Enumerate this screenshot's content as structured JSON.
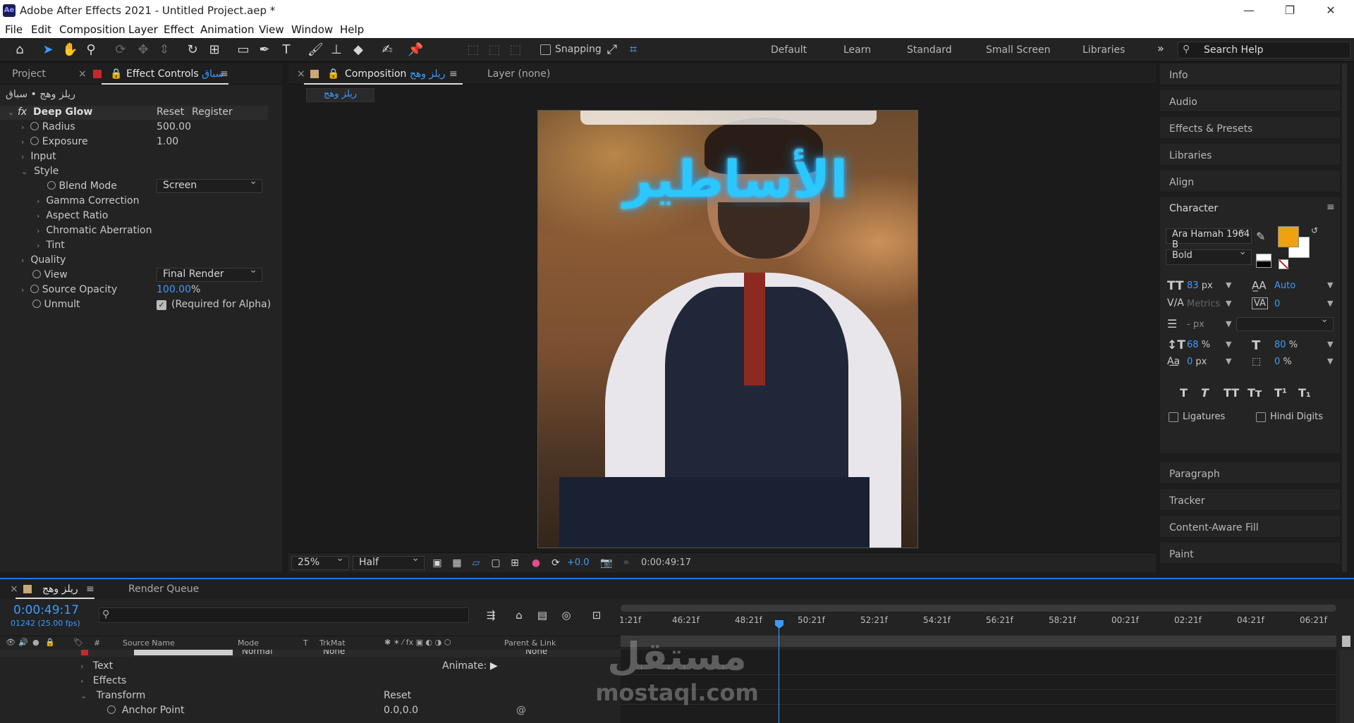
{
  "window": {
    "title": "Adobe After Effects 2021 - Untitled Project.aep *",
    "app_icon": "Ae",
    "minimize": "—",
    "maximize": "❐",
    "close": "✕"
  },
  "menu": [
    "File",
    "Edit",
    "Composition",
    "Layer",
    "Effect",
    "Animation",
    "View",
    "Window",
    "Help"
  ],
  "toolbar": {
    "snapping_label": "Snapping",
    "workspaces": [
      "Default",
      "Learn",
      "Standard",
      "Small Screen",
      "Libraries"
    ],
    "overflow": "»",
    "search_placeholder": "Search Help"
  },
  "left_panel": {
    "tab_project": "Project",
    "tab_effect_controls": "Effect Controls",
    "tab_layer_name": "سباق",
    "breadcrumb": "ريلز وهج • سباق",
    "effect": {
      "name": "Deep Glow",
      "fx": "fx",
      "reset": "Reset",
      "register": "Register",
      "radius_label": "Radius",
      "radius_value": "500.00",
      "exposure_label": "Exposure",
      "exposure_value": "1.00",
      "input_label": "Input",
      "style_label": "Style",
      "blend_mode_label": "Blend Mode",
      "blend_mode_value": "Screen",
      "gamma_label": "Gamma Correction",
      "aspect_label": "Aspect Ratio",
      "chromatic_label": "Chromatic Aberration",
      "tint_label": "Tint",
      "quality_label": "Quality",
      "view_label": "View",
      "view_value": "Final Render",
      "source_opacity_label": "Source Opacity",
      "source_opacity_value": "100.00",
      "source_opacity_unit": "%",
      "unmult_label": "Unmult",
      "unmult_note": "(Required for Alpha)"
    }
  },
  "comp_panel": {
    "tab_composition": "Composition",
    "comp_name": "ريلز وهج",
    "tab_layer": "Layer",
    "layer_none": "(none)",
    "comp_subtab": "ريلز وهج",
    "overlay_text": "الأساطير",
    "footer": {
      "zoom": "25%",
      "resolution": "Half",
      "exposure": "+0.0",
      "timecode": "0:00:49:17"
    }
  },
  "right_panel": {
    "items_top": [
      "Info",
      "Audio",
      "Effects & Presets",
      "Libraries",
      "Align"
    ],
    "character": {
      "title": "Character",
      "font": "Ara Hamah 1964 B",
      "style": "Bold",
      "fill_color": "#f0a010",
      "size": "83",
      "size_unit": "px",
      "leading": "Auto",
      "kerning": "Metrics",
      "tracking": "0",
      "stroke": "-",
      "stroke_unit": "px",
      "vscale": "68",
      "vscale_unit": "%",
      "hscale": "80",
      "hscale_unit": "%",
      "baseline": "0",
      "baseline_unit": "px",
      "tsume": "0",
      "tsume_unit": "%",
      "styles": [
        "T",
        "T",
        "TT",
        "Tт",
        "T¹",
        "T₁"
      ],
      "ligatures": "Ligatures",
      "hindi_digits": "Hindi Digits"
    },
    "items_bottom": [
      "Paragraph",
      "Tracker",
      "Content-Aware Fill",
      "Paint"
    ]
  },
  "timeline": {
    "tab_comp": "ريلز وهج",
    "tab_render_queue": "Render Queue",
    "current_time": "0:00:49:17",
    "frame_info": "01242 (25.00 fps)",
    "columns": {
      "num": "#",
      "source": "Source Name",
      "mode": "Mode",
      "t": "T",
      "trkmat": "TrkMat",
      "parent": "Parent & Link"
    },
    "layer_row": {
      "mode": "Normal",
      "trkmat": "None",
      "parent": "None"
    },
    "rows": {
      "text": "Text",
      "animate": "Animate:",
      "effects": "Effects",
      "transform": "Transform",
      "reset": "Reset",
      "anchor_point": "Anchor Point",
      "anchor_value": "0.0,0.0"
    },
    "ruler": [
      "1:21f",
      "46:21f",
      "48:21f",
      "50:21f",
      "52:21f",
      "54:21f",
      "56:21f",
      "58:21f",
      "00:21f",
      "02:21f",
      "04:21f",
      "06:21f"
    ]
  },
  "watermark": {
    "line1": "مستقل",
    "line2": "mostaql.com"
  }
}
